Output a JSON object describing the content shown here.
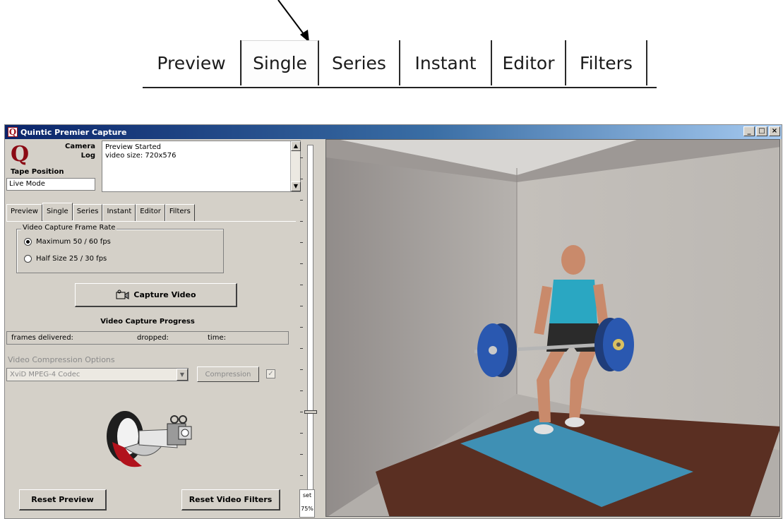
{
  "zoomed_tabs": [
    "Preview",
    "Single",
    "Series",
    "Instant",
    "Editor",
    "Filters"
  ],
  "window": {
    "title": "Quintic Premier Capture",
    "app_icon_letter": "Q",
    "controls": {
      "minimize": "_",
      "maximize": "□",
      "close": "×"
    }
  },
  "header": {
    "logo_letter": "Q",
    "camera_label": "Camera",
    "log_label": "Log",
    "tape_position_label": "Tape Position",
    "tape_position_value": "Live Mode",
    "log_lines": [
      "Preview Started",
      "video size: 720x576"
    ]
  },
  "tabs": [
    "Preview",
    "Single",
    "Series",
    "Instant",
    "Editor",
    "Filters"
  ],
  "single": {
    "frame_rate_title": "Video Capture Frame Rate",
    "options": [
      {
        "label": "Maximum  50 / 60 fps",
        "selected": true
      },
      {
        "label": "Half Size  25 / 30 fps",
        "selected": false
      }
    ],
    "capture_button": "Capture Video",
    "progress_title": "Video Capture Progress",
    "frames_delivered": "frames delivered:",
    "dropped": "dropped:",
    "time": "time:",
    "compression_title": "Video Compression Options",
    "codec": "XviD MPEG-4 Codec",
    "compression_button": "Compression",
    "compression_checked": true
  },
  "buttons": {
    "reset_preview": "Reset Preview",
    "reset_filters": "Reset Video Filters"
  },
  "zoom": {
    "label": "set",
    "value": "75%"
  }
}
